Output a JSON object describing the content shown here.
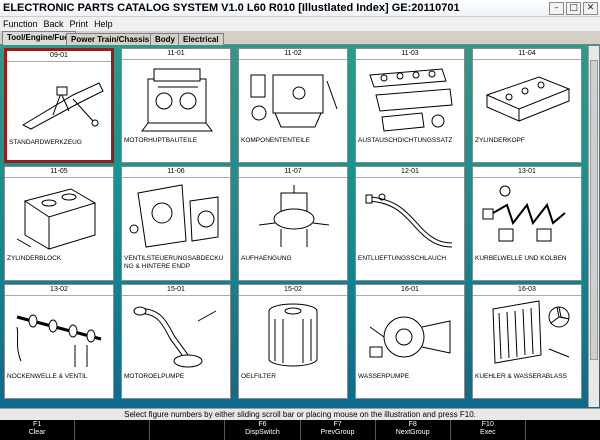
{
  "window": {
    "title": "ELECTRONIC PARTS CATALOG SYSTEM V1.0 L60 R010 [Illustlated Index] GE:20110701",
    "minimize_glyph": "–",
    "maximize_glyph": "□",
    "close_glyph": "✕"
  },
  "menu": [
    "Function",
    "Back",
    "Print",
    "Help"
  ],
  "tabs": [
    "Tool/Engine/Fuel",
    "Power Train/Chassis",
    "Body",
    "Electrical"
  ],
  "cards": [
    {
      "code": "09-01",
      "label": "STANDARDWERKZEUG",
      "icon": "jack-icon"
    },
    {
      "code": "11-01",
      "label": "MOTORHUPTBAUTEILE",
      "icon": "engine-block-icon"
    },
    {
      "code": "11-02",
      "label": "KOMPONENTENTEILE",
      "icon": "engine-components-icon"
    },
    {
      "code": "11-03",
      "label": "AUSTAUSCHDICHTUNGSSATZ",
      "icon": "gasket-set-icon"
    },
    {
      "code": "11-04",
      "label": "ZYLINDERKOPF",
      "icon": "cylinder-head-icon"
    },
    {
      "code": "11-05",
      "label": "ZYLINDERBLOCK",
      "icon": "cylinder-block-icon"
    },
    {
      "code": "11-06",
      "label": "VENTILSTEUERUNGSABDECKUNG & HINTERE ENDP",
      "icon": "timing-cover-icon"
    },
    {
      "code": "11-07",
      "label": "AUFHAENGUNG",
      "icon": "engine-mount-icon"
    },
    {
      "code": "12-01",
      "label": "ENTLUEFTUNGSSCHLAUCH",
      "icon": "breather-hose-icon"
    },
    {
      "code": "13-01",
      "label": "KURBELWELLE UND KOLBEN",
      "icon": "crankshaft-icon"
    },
    {
      "code": "13-02",
      "label": "NOCKENWELLE & VENTIL",
      "icon": "camshaft-icon"
    },
    {
      "code": "15-01",
      "label": "MOTOROELPUMPE",
      "icon": "oil-pump-icon"
    },
    {
      "code": "15-02",
      "label": "OELFILTER",
      "icon": "oil-filter-icon"
    },
    {
      "code": "16-01",
      "label": "WASSERPUMPE",
      "icon": "water-pump-icon"
    },
    {
      "code": "16-03",
      "label": "KUEHLER & WASSERABLASS",
      "icon": "radiator-icon"
    }
  ],
  "status_text": "Select figure numbers by either sliding scroll bar or placing mouse on the illustration and press F10.",
  "fkeys": [
    {
      "key": "F1",
      "label": "Clear"
    },
    {
      "key": "",
      "label": ""
    },
    {
      "key": "",
      "label": ""
    },
    {
      "key": "F6",
      "label": "DispSwitch"
    },
    {
      "key": "F7",
      "label": "PrevGroup"
    },
    {
      "key": "F8",
      "label": "NextGroup"
    },
    {
      "key": "F10",
      "label": "Exec"
    },
    {
      "key": "",
      "label": ""
    }
  ]
}
